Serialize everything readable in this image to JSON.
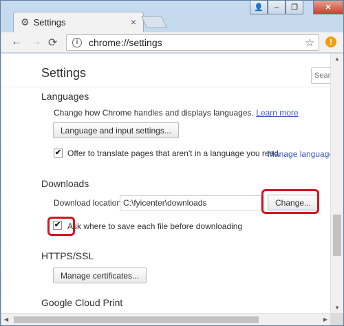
{
  "tab": {
    "title": "Settings",
    "close_glyph": "×",
    "icon": "gear-icon"
  },
  "window_controls": {
    "user": "👤",
    "minimize": "–",
    "maximize": "❐",
    "close": "✕"
  },
  "toolbar": {
    "back": "←",
    "forward": "→",
    "reload": "⟳",
    "url": "chrome://settings",
    "info_glyph": "i",
    "star": "☆",
    "extension": "!"
  },
  "page": {
    "title": "Settings",
    "search_placeholder": "Search"
  },
  "languages": {
    "heading": "Languages",
    "description": "Change how Chrome handles and displays languages.",
    "learn_more": "Learn more",
    "settings_button": "Language and input settings...",
    "offer_translate_label": "Offer to translate pages that aren't in a language you read.",
    "manage_languages": "Manage languages",
    "offer_translate_checked": true
  },
  "downloads": {
    "heading": "Downloads",
    "location_label": "Download location:",
    "location_value": "C:\\fyicenter\\downloads",
    "change_button": "Change...",
    "ask_label": "Ask where to save each file before downloading",
    "ask_checked": true
  },
  "https": {
    "heading": "HTTPS/SSL",
    "manage_button": "Manage certificates..."
  },
  "cloud_print": {
    "heading": "Google Cloud Print"
  },
  "colors": {
    "highlight": "#d3131f",
    "link": "#3a59b5"
  }
}
